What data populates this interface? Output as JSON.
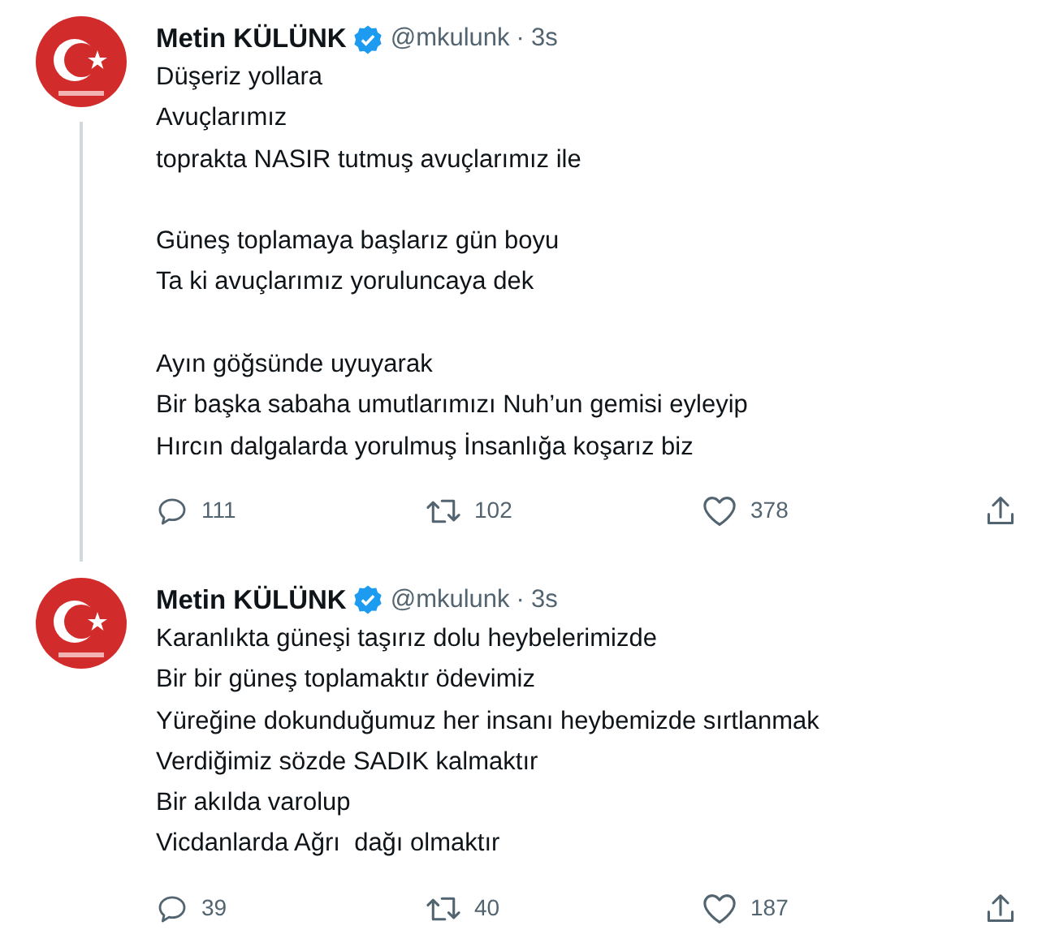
{
  "tweets": [
    {
      "name": "Metin KÜLÜNK",
      "verified": true,
      "handle": "@mkulunk",
      "separator": "·",
      "time": "3s",
      "thread_line": true,
      "text": "Düşeriz yollara\nAvuçlarımız\ntoprakta NASIR tutmuş avuçlarımız ile\n\nGüneş toplamaya başlarız gün boyu\nTa ki avuçlarımız yoruluncaya dek\n\nAyın göğsünde uyuyarak\nBir başka sabaha umutlarımızı Nuh’un gemisi eyleyip\nHırcın dalgalarda yorulmuş İnsanlığa koşarız biz",
      "replies": "111",
      "retweets": "102",
      "likes": "378"
    },
    {
      "name": "Metin KÜLÜNK",
      "verified": true,
      "handle": "@mkulunk",
      "separator": "·",
      "time": "3s",
      "thread_line": false,
      "text": "Karanlıkta güneşi taşırız dolu heybelerimizde\nBir bir güneş toplamaktır ödevimiz\nYüreğine dokunduğumuz her insanı heybemizde sırtlanmak\nVerdiğimiz sözde SADIK kalmaktır\nBir akılda varolup\nVicdanlarda Ağrı  dağı olmaktır",
      "replies": "39",
      "retweets": "40",
      "likes": "187"
    }
  ]
}
